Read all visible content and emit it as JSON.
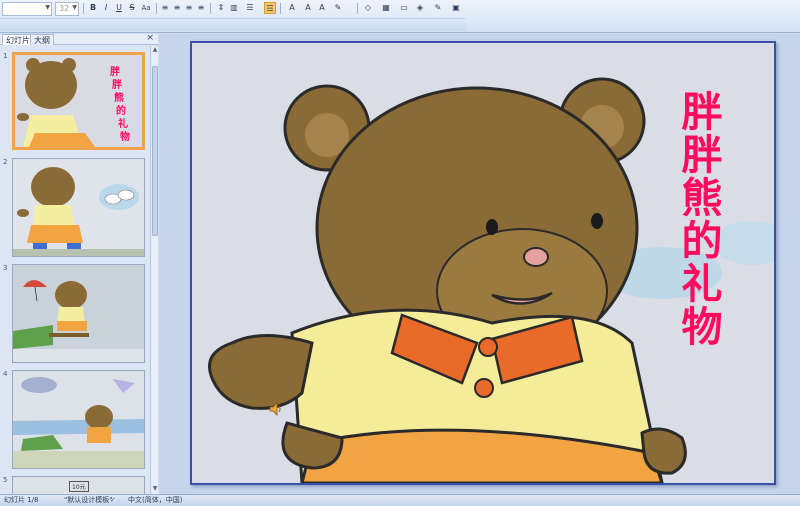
{
  "toolbar": {
    "font_name": "",
    "font_size": "32",
    "buttons": [
      "bold-button",
      "italic-button",
      "underline-button",
      "strikethrough-button",
      "shadow-button"
    ]
  },
  "panel": {
    "tab_slides": "幻灯片",
    "tab_outline": "大纲",
    "close_glyph": "×",
    "thumbnails": [
      {
        "num": "1",
        "title_text": "胖胖熊的礼物"
      },
      {
        "num": "2"
      },
      {
        "num": "3"
      },
      {
        "num": "4"
      },
      {
        "num": "5",
        "partial_text": "10元"
      }
    ]
  },
  "slide": {
    "title_chars": [
      "胖",
      "胖",
      "熊",
      "的",
      "礼",
      "物"
    ],
    "sound_icon": "speaker-icon"
  },
  "status": {
    "slide_info": "幻灯片 1/8",
    "template": "\"默认设计模板\"",
    "language": "中文(简体，中国)"
  },
  "colors": {
    "title_red": "#ff0c5f",
    "selected_thumb": "#f2a24b",
    "slide_border": "#3a4fa8"
  }
}
